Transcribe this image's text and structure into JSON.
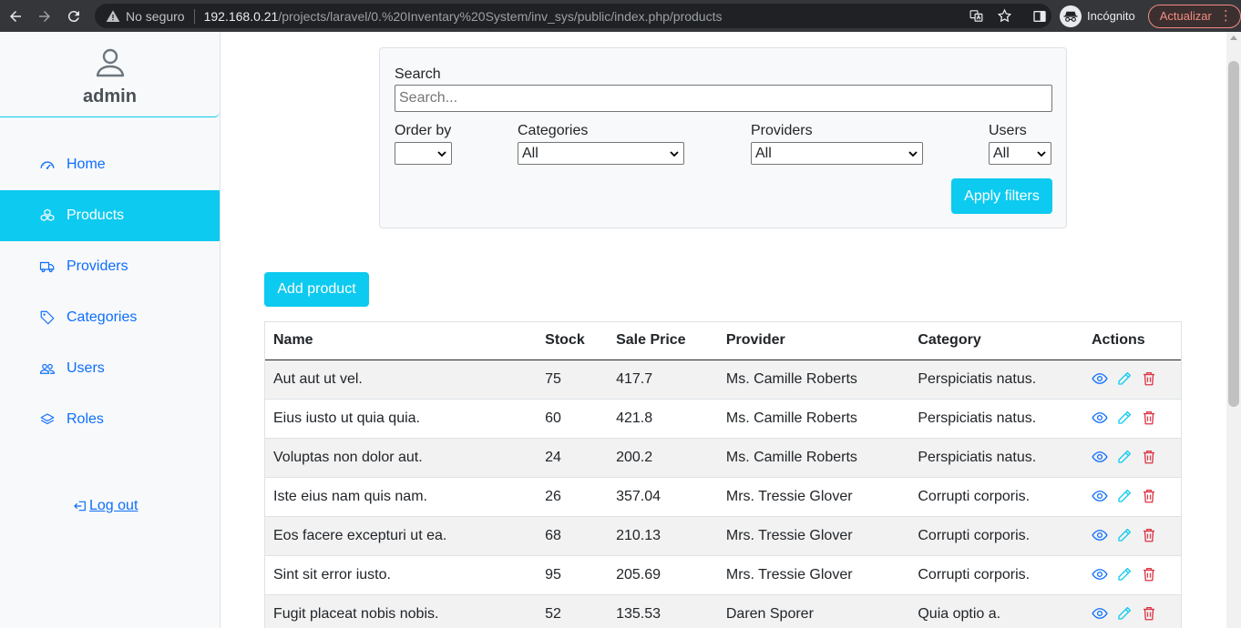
{
  "browser": {
    "not_secure_label": "No seguro",
    "url_host": "192.168.0.21",
    "url_path": "/projects/laravel/0.%20Inventary%20System/inv_sys/public/index.php/products",
    "incognito_label": "Incógnito",
    "update_label": "Actualizar"
  },
  "sidebar": {
    "username": "admin",
    "items": [
      {
        "label": "Home",
        "icon": "speedometer-icon"
      },
      {
        "label": "Products",
        "icon": "boxes-icon"
      },
      {
        "label": "Providers",
        "icon": "truck-icon"
      },
      {
        "label": "Categories",
        "icon": "tag-icon"
      },
      {
        "label": "Users",
        "icon": "people-icon"
      },
      {
        "label": "Roles",
        "icon": "layers-icon"
      }
    ],
    "active_item": "Products",
    "logout_label": "Log out"
  },
  "filters": {
    "search_label": "Search",
    "search_placeholder": "Search...",
    "search_value": "",
    "order_by_label": "Order by",
    "order_by_value": "",
    "categories_label": "Categories",
    "categories_value": "All",
    "providers_label": "Providers",
    "providers_value": "All",
    "users_label": "Users",
    "users_value": "All",
    "apply_label": "Apply filters"
  },
  "add_product_label": "Add product",
  "table": {
    "headers": [
      "Name",
      "Stock",
      "Sale Price",
      "Provider",
      "Category",
      "Actions"
    ],
    "rows": [
      {
        "name": "Aut aut ut vel.",
        "stock": "75",
        "price": "417.7",
        "provider": "Ms. Camille Roberts",
        "category": "Perspiciatis natus."
      },
      {
        "name": "Eius iusto ut quia quia.",
        "stock": "60",
        "price": "421.8",
        "provider": "Ms. Camille Roberts",
        "category": "Perspiciatis natus."
      },
      {
        "name": "Voluptas non dolor aut.",
        "stock": "24",
        "price": "200.2",
        "provider": "Ms. Camille Roberts",
        "category": "Perspiciatis natus."
      },
      {
        "name": "Iste eius nam quis nam.",
        "stock": "26",
        "price": "357.04",
        "provider": "Mrs. Tressie Glover",
        "category": "Corrupti corporis."
      },
      {
        "name": "Eos facere excepturi ut ea.",
        "stock": "68",
        "price": "210.13",
        "provider": "Mrs. Tressie Glover",
        "category": "Corrupti corporis."
      },
      {
        "name": "Sint sit error iusto.",
        "stock": "95",
        "price": "205.69",
        "provider": "Mrs. Tressie Glover",
        "category": "Corrupti corporis."
      },
      {
        "name": "Fugit placeat nobis nobis.",
        "stock": "52",
        "price": "135.53",
        "provider": "Daren Sporer",
        "category": "Quia optio a."
      }
    ]
  },
  "colors": {
    "accent": "#0dcaf0",
    "link": "#0d6efd",
    "delete": "#dc3545"
  }
}
